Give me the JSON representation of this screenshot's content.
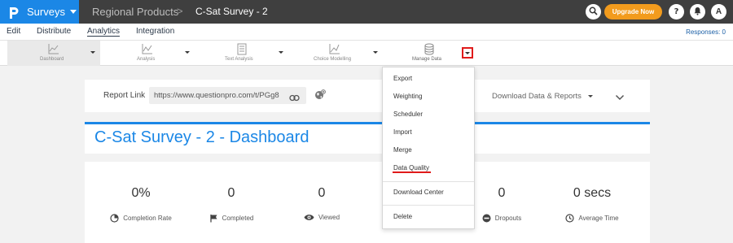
{
  "header": {
    "app_name": "Surveys",
    "breadcrumb": [
      "Regional Products",
      "C-Sat Survey - 2"
    ],
    "breadcrumb_separator": ">",
    "upgrade_label": "Upgrade Now",
    "avatar_initial": "A",
    "colors": {
      "bar": "#3f3f3f",
      "brand": "#1b87e6",
      "upgrade": "#f29b1d"
    }
  },
  "subnav": {
    "tabs": [
      "Edit",
      "Distribute",
      "Analytics",
      "Integration"
    ],
    "active_tab": "Analytics",
    "responses": "Responses: 0"
  },
  "toolbar": {
    "items": [
      {
        "label": "Dashboard",
        "icon": "line-chart-icon"
      },
      {
        "label": "Analysis",
        "icon": "line-chart-icon"
      },
      {
        "label": "Text Analysis",
        "icon": "document-icon"
      },
      {
        "label": "Choice Modelling",
        "icon": "line-chart-icon"
      },
      {
        "label": "Manage Data",
        "icon": "database-icon"
      }
    ]
  },
  "report": {
    "label": "Report Link",
    "url": "https://www.questionpro.com/t/PGg8",
    "download_label": "Download Data & Reports"
  },
  "dashboard": {
    "title": "C-Sat Survey - 2 - Dashboard",
    "stats": [
      {
        "value": "0%",
        "label": "Completion Rate",
        "icon": "pie-icon"
      },
      {
        "value": "0",
        "label": "Completed",
        "icon": "flag-icon"
      },
      {
        "value": "0",
        "label": "Viewed",
        "icon": "eye-icon"
      },
      {
        "value": "0",
        "label": "Dropouts",
        "icon": "minus-circle-icon"
      },
      {
        "value": "0 secs",
        "label": "Average Time",
        "icon": "clock-icon"
      }
    ]
  },
  "manage_data_menu": {
    "items": [
      "Export",
      "Weighting",
      "Scheduler",
      "Import",
      "Merge",
      "Data Quality",
      "Download Center",
      "Delete"
    ],
    "highlighted": "Data Quality"
  }
}
